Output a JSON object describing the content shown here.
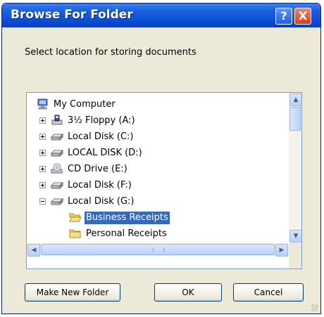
{
  "window": {
    "title": "Browse For Folder",
    "help_button": "?",
    "close_button": "X"
  },
  "description": "Select location for storing documents",
  "tree": [
    {
      "label": "My Computer",
      "icon": "computer-icon",
      "expander": "none",
      "level": 0
    },
    {
      "label": "3½ Floppy (A:)",
      "icon": "floppy-drive-icon",
      "expander": "plus",
      "level": 1
    },
    {
      "label": "Local Disk (C:)",
      "icon": "hard-disk-icon",
      "expander": "plus",
      "level": 1
    },
    {
      "label": "LOCAL DISK (D:)",
      "icon": "hard-disk-icon",
      "expander": "plus",
      "level": 1
    },
    {
      "label": "CD Drive (E:)",
      "icon": "cd-drive-icon",
      "expander": "plus",
      "level": 1
    },
    {
      "label": "Local Disk (F:)",
      "icon": "hard-disk-icon",
      "expander": "plus",
      "level": 1
    },
    {
      "label": "Local Disk (G:)",
      "icon": "hard-disk-icon",
      "expander": "minus",
      "level": 1
    },
    {
      "label": "Business Receipts",
      "icon": "open-folder-icon",
      "expander": "none",
      "level": 2,
      "selected": true
    },
    {
      "label": "Personal Receipts",
      "icon": "folder-icon",
      "expander": "none",
      "level": 2
    }
  ],
  "buttons": {
    "make_new_folder": "Make New Folder",
    "ok": "OK",
    "cancel": "Cancel"
  },
  "colors": {
    "titlebar": "#0a4fd6",
    "selection": "#316ac5",
    "dialog_bg": "#ece9d8"
  }
}
